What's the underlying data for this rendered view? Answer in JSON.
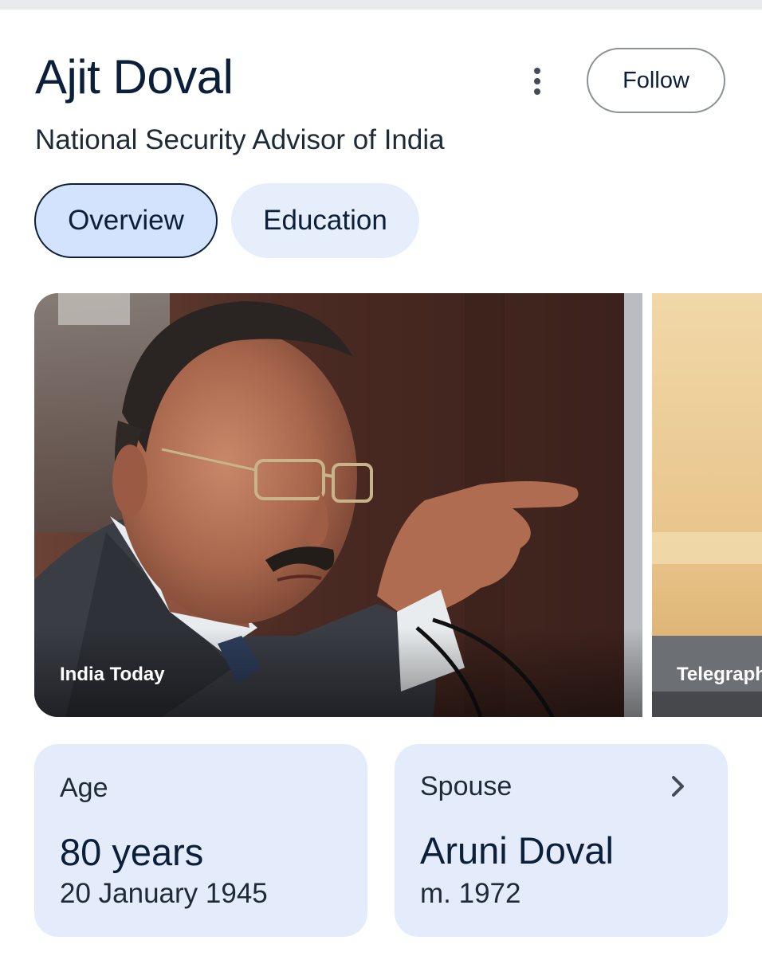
{
  "entity": {
    "title": "Ajit Doval",
    "subtitle": "National Security Advisor of India"
  },
  "actions": {
    "more_icon": "more-vert-icon",
    "follow_label": "Follow"
  },
  "tabs": [
    {
      "label": "Overview",
      "selected": true
    },
    {
      "label": "Education",
      "selected": false
    }
  ],
  "images": [
    {
      "source": "India Today"
    },
    {
      "source": "Telegraph"
    }
  ],
  "facts": {
    "age": {
      "label": "Age",
      "value": "80 years",
      "detail": "20 January 1945"
    },
    "spouse": {
      "label": "Spouse",
      "value": "Aruni Doval",
      "detail": "m. 1972",
      "icon": "chevron-right-icon"
    }
  },
  "colors": {
    "title": "#0b1f3a",
    "chip_selected": "#d3e3fd",
    "chip": "#e6edfb",
    "card": "#e4ecfc"
  }
}
